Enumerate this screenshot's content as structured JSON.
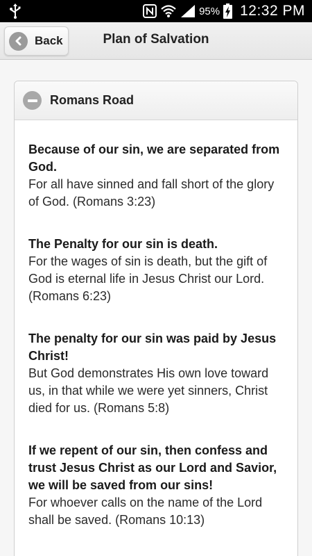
{
  "status_bar": {
    "battery_percent": "95%",
    "time": "12:32 PM",
    "icons": [
      "usb-icon",
      "nfc-icon",
      "wifi-icon",
      "signal-icon",
      "battery-charging-icon"
    ]
  },
  "header": {
    "back_label": "Back",
    "title": "Plan of Salvation"
  },
  "section": {
    "title": "Romans Road",
    "expanded": true,
    "items": [
      {
        "heading": "Because of our sin, we are separated from God.",
        "text": "For all have sinned and fall short of the glory of God. (Romans 3:23)"
      },
      {
        "heading": "The Penalty for our sin is death.",
        "text": "For the wages of sin is death, but the gift of God is eternal life in Jesus Christ our Lord. (Romans 6:23)"
      },
      {
        "heading": "The penalty for our sin was paid by Jesus Christ!",
        "text": "But God demonstrates His own love toward us, in that while we were yet sinners, Christ died for us. (Romans 5:8)"
      },
      {
        "heading": "If we repent of our sin, then confess and trust Jesus Christ as our Lord and Savior, we will be saved from our sins!",
        "text": "For whoever calls on the name of the Lord shall be saved. (Romans 10:13)"
      }
    ]
  }
}
